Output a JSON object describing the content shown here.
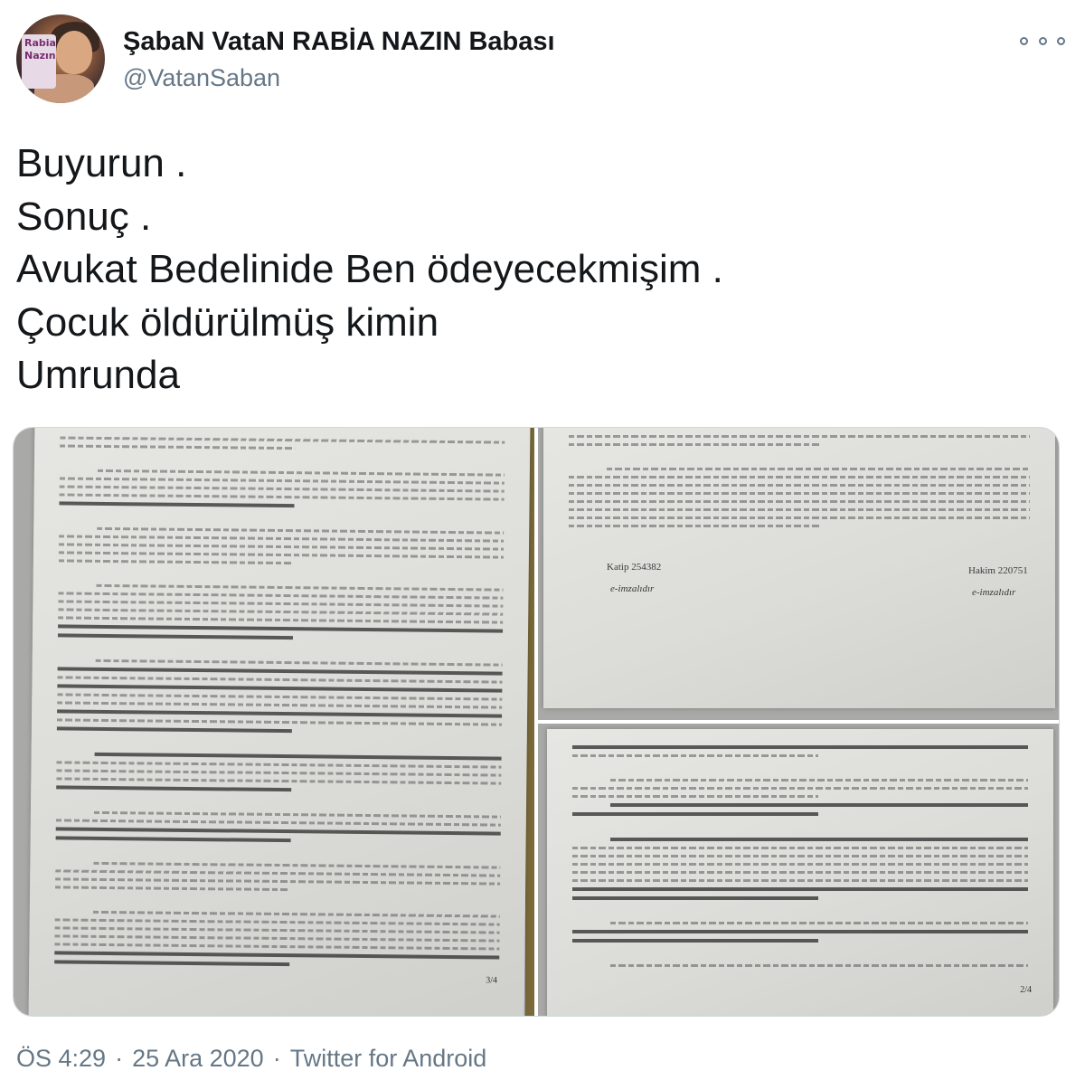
{
  "user": {
    "display_name": "ŞabaN VataN RABİA NAZIN Babası",
    "handle": "@VatanSaban",
    "avatar_poster_text": "Rabia Nazın"
  },
  "tweet": {
    "lines": [
      "Buyurun .",
      "Sonuç .",
      "Avukat Bedelinide Ben ödeyecekmişim .",
      "Çocuk öldürülmüş kimin",
      "Umrunda"
    ]
  },
  "media": {
    "images": [
      {
        "alt": "court-document-page-3",
        "page_label": "3/4"
      },
      {
        "alt": "court-document-signatures",
        "signatures": [
          "Katip 254382",
          "Hakim 220751"
        ],
        "esign": "e-imzalıdır"
      },
      {
        "alt": "court-document-page-2",
        "page_label": "2/4"
      }
    ]
  },
  "meta": {
    "time": "ÖS 4:29",
    "date": "25 Ara 2020",
    "source": "Twitter for Android",
    "separator": "·"
  },
  "icons": {
    "more": "more-options-icon"
  },
  "colors": {
    "text_primary": "#14171a",
    "text_secondary": "#657786",
    "border": "#cfd9de"
  }
}
